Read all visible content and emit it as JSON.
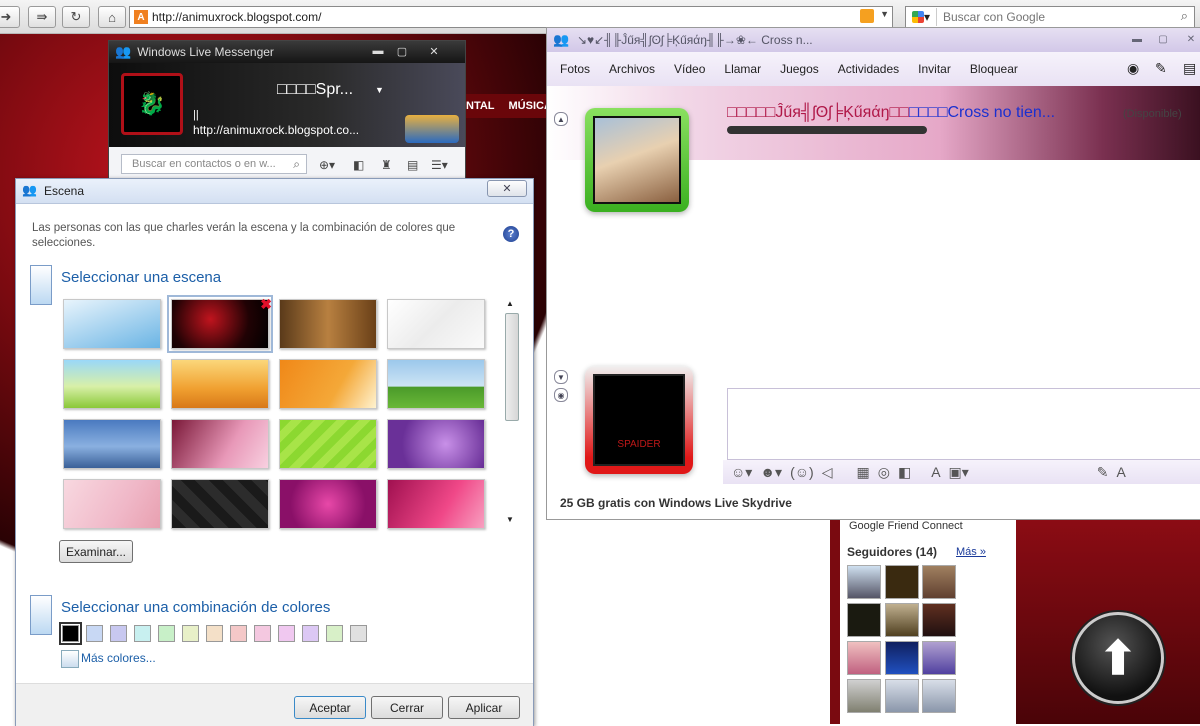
{
  "browser": {
    "url": "http://animuxrock.blogspot.com/",
    "search_placeholder": "Buscar con Google",
    "icons": [
      "back-icon",
      "forward-icon",
      "reload-icon",
      "home-icon"
    ]
  },
  "blog": {
    "nav_items": [
      "NTAL",
      "MÚSICA"
    ],
    "gfc_title": "Google Friend Connect",
    "followers_title": "Seguidores (14)",
    "followers_more": "Más »"
  },
  "messenger": {
    "title": "Windows Live Messenger",
    "display_name": "□□□□Spr...",
    "personal_msg": "http://animuxrock.blogspot.co...",
    "cursor": "||",
    "search_placeholder": "Buscar en contactos o en w..."
  },
  "escena": {
    "title": "Escena",
    "description": "Las personas con las que charles verán la escena y la combinación de colores que selecciones.",
    "scene_section_title": "Seleccionar una escena",
    "browse_label": "Examinar...",
    "color_section_title": "Seleccionar una combinación de colores",
    "more_colors": "Más colores...",
    "buttons": {
      "accept": "Aceptar",
      "close": "Cerrar",
      "apply": "Aplicar"
    },
    "scenes": [
      {
        "name": "sky"
      },
      {
        "name": "custom-red",
        "selected": true
      },
      {
        "name": "old-paper"
      },
      {
        "name": "white-waves"
      },
      {
        "name": "green-hill"
      },
      {
        "name": "autumn-tree"
      },
      {
        "name": "orange-grass"
      },
      {
        "name": "field"
      },
      {
        "name": "mountains"
      },
      {
        "name": "pink-pattern"
      },
      {
        "name": "green-stripes"
      },
      {
        "name": "purple-swirl"
      },
      {
        "name": "cherry-blossom"
      },
      {
        "name": "dark-cubes"
      },
      {
        "name": "magenta-heart"
      },
      {
        "name": "pink-glow"
      }
    ],
    "swatches": [
      "#000000",
      "#c8d8f4",
      "#c8c8f0",
      "#c8f0f0",
      "#c8f0c8",
      "#e8f0c8",
      "#f4e0c8",
      "#f4c8c8",
      "#f4c8e0",
      "#f0c8f0",
      "#dcc8f4",
      "#d8f0c8",
      "#e0e0e0"
    ]
  },
  "conversation": {
    "title": "↘♥↙╢╟Ĵűя╣ʃʘʃ╞Ķűяάŋ╢╟→❀← Cross n...",
    "menu": [
      "Fotos",
      "Archivos",
      "Vídeo",
      "Llamar",
      "Juegos",
      "Actividades",
      "Invitar",
      "Bloquear"
    ],
    "contact_name": "□□□□□Ĵűя╣ʃʘʃ╞Ķűяάŋ□□",
    "contact_name_tail": "□□□□Cross no tien...",
    "contact_status": "(Disponible)",
    "ad_text": "25 GB gratis con Windows Live Skydrive",
    "avatar_caption": "SPAIDER"
  }
}
